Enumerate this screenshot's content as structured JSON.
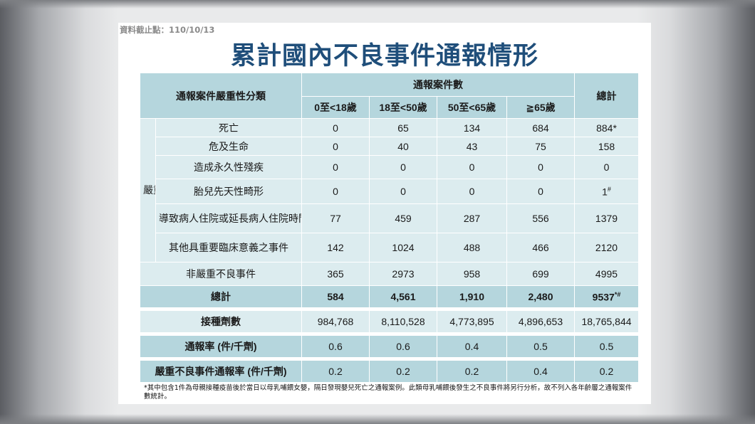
{
  "header": {
    "date_label": "資料截止點：110/10/13",
    "title": "累計國內不良事件通報情形"
  },
  "table": {
    "category_header": "通報案件嚴重性分類",
    "count_header": "通報案件數",
    "total_header": "總計",
    "age_groups": [
      "0至<18歲",
      "18至<50歲",
      "50至<65歲",
      "≧65歲"
    ],
    "serious_label": "嚴重不良事件",
    "serious_rows": [
      {
        "label": "死亡",
        "values": [
          "0",
          "65",
          "134",
          "684"
        ],
        "total": "884",
        "mark": "*"
      },
      {
        "label": "危及生命",
        "values": [
          "0",
          "40",
          "43",
          "75"
        ],
        "total": "158",
        "mark": ""
      },
      {
        "label": "造成永久性殘疾",
        "values": [
          "0",
          "0",
          "0",
          "0"
        ],
        "total": "0",
        "mark": ""
      },
      {
        "label": "胎兒先天性畸形",
        "values": [
          "0",
          "0",
          "0",
          "0"
        ],
        "total": "1",
        "mark": "#"
      },
      {
        "label": "導致病人住院或延長病人住院時間",
        "values": [
          "77",
          "459",
          "287",
          "556"
        ],
        "total": "1379",
        "mark": ""
      },
      {
        "label": "其他具重要臨床意義之事件",
        "values": [
          "142",
          "1024",
          "488",
          "466"
        ],
        "total": "2120",
        "mark": ""
      }
    ],
    "non_serious_row": {
      "label": "非嚴重不良事件",
      "values": [
        "365",
        "2973",
        "958",
        "699"
      ],
      "total": "4995"
    },
    "total_row": {
      "label": "總計",
      "values": [
        "584",
        "4,561",
        "1,910",
        "2,480"
      ],
      "total": "9537",
      "mark": "*#"
    },
    "doses_row": {
      "label": "接種劑數",
      "values": [
        "984,768",
        "8,110,528",
        "4,773,895",
        "4,896,653"
      ],
      "total": "18,765,844"
    },
    "rate_row": {
      "label": "通報率 (件/千劑)",
      "values": [
        "0.6",
        "0.6",
        "0.4",
        "0.5"
      ],
      "total": "0.5"
    },
    "serious_rate_row": {
      "label": "嚴重不良事件通報率 (件/千劑)",
      "values": [
        "0.2",
        "0.2",
        "0.2",
        "0.4"
      ],
      "total": "0.2"
    }
  },
  "footnote": "*其中包含1件為母親接種疫苗後於當日以母乳哺餵女嬰，隔日發現嬰兒死亡之通報案例。此類母乳哺餵後發生之不良事件將另行分析，故不列入各年齡層之通報案件數統計。"
}
